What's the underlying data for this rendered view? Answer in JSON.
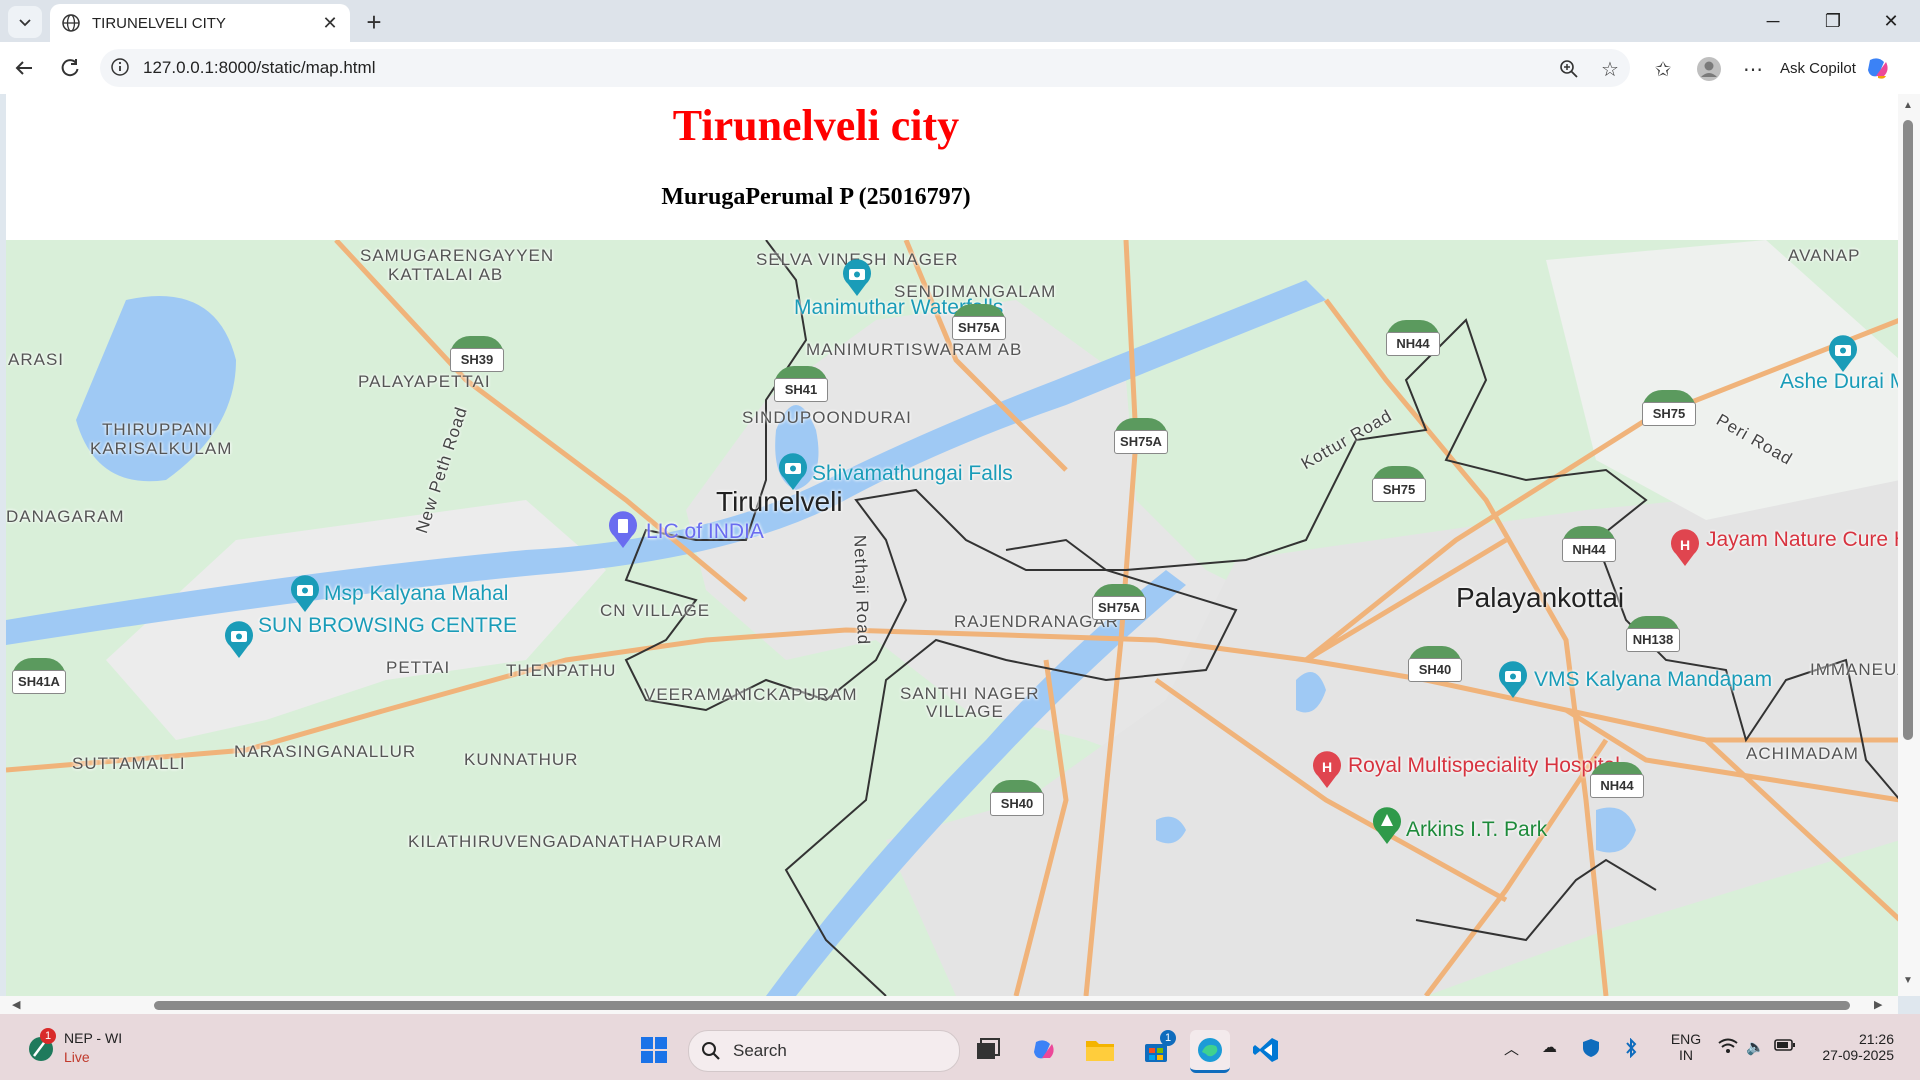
{
  "browser": {
    "tab_title": "TIRUNELVELI CITY",
    "url": "127.0.0.1:8000/static/map.html",
    "copilot_label": "Ask Copilot"
  },
  "page": {
    "title": "Tirunelveli city",
    "subtitle": "MurugaPerumal P (25016797)"
  },
  "map": {
    "place_labels": [
      "SAMUGARENGAYYEN",
      "KATTALAI AB",
      "SELVA VINESH NAGER",
      "SENDIMANGALAM",
      "AVANAP",
      "ARASI",
      "PALAYAPETTAI",
      "MANIMURTISWARAM AB",
      "SINDUPOONDURAI",
      "THIRUPPANI",
      "KARISALKULAM",
      "DANAGARAM",
      "CN VILLAGE",
      "RAJENDRANAGAR",
      "PETTAI",
      "THENPATHU",
      "VEERAMANICKAPURAM",
      "SANTHI NAGER",
      "VILLAGE",
      "IMMANEUAL",
      "SUTTAMALLI",
      "NARASINGANALLUR",
      "KUNNATHUR",
      "ACHIMADAM",
      "KILATHIRUVENGADANATHAPURAM"
    ],
    "road_labels": [
      "New Peth Road",
      "Nethaji Road",
      "Kottur Road",
      "Peri Road"
    ],
    "cities": [
      "Tirunelveli",
      "Palayankottai"
    ],
    "pois": {
      "manimuthar": "Manimuthar Waterfalls",
      "shivamathungai": "Shivamathungai Falls",
      "lic": "LIC of INDIA",
      "msp": "Msp Kalyana Mahal",
      "sun": "SUN BROWSING CENTRE",
      "ashe": "Ashe Durai Memorial",
      "jayam": "Jayam Nature Cure Hospital",
      "vms": "VMS Kalyana Mandapam",
      "royal": "Royal Multispeciality Hospital",
      "arkins": "Arkins I.T. Park"
    },
    "shields": [
      "SH75A",
      "SH39",
      "SH41",
      "NH44",
      "SH75A",
      "SH75",
      "SH75",
      "NH44",
      "SH75A",
      "NH138",
      "SH41A",
      "SH40",
      "NH44",
      "SH40"
    ]
  },
  "taskbar": {
    "weather_title": "NEP - WI",
    "weather_status": "Live",
    "weather_badge": "1",
    "search_placeholder": "Search",
    "store_badge": "1",
    "lang_top": "ENG",
    "lang_bottom": "IN",
    "time": "21:26",
    "date": "27-09-2025"
  }
}
